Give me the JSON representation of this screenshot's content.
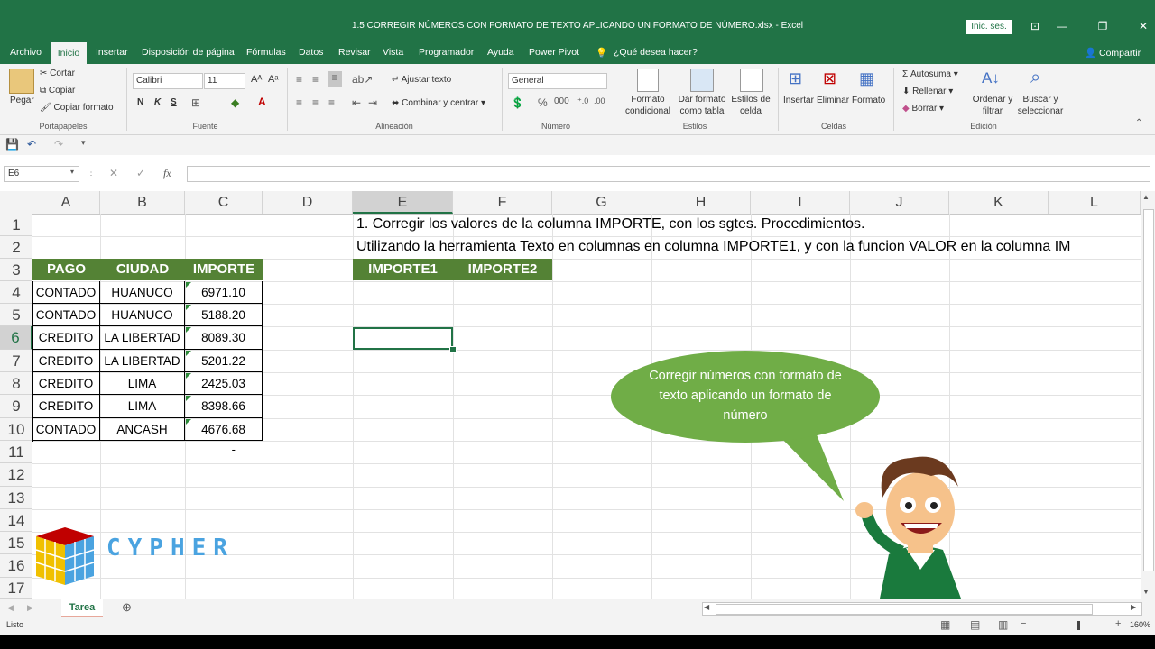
{
  "window": {
    "title": "1.5 CORREGIR NÚMEROS CON FORMATO DE TEXTO APLICANDO UN FORMATO DE NÚMERO.xlsx  -  Excel",
    "signin": "Inic. ses.",
    "share": "Compartir"
  },
  "tabs": [
    "Archivo",
    "Inicio",
    "Insertar",
    "Disposición de página",
    "Fórmulas",
    "Datos",
    "Revisar",
    "Vista",
    "Programador",
    "Ayuda",
    "Power Pivot",
    "¿Qué desea hacer?"
  ],
  "ribbon": {
    "portapapeles": {
      "label": "Portapapeles",
      "pegar": "Pegar",
      "cortar": "Cortar",
      "copiar": "Copiar",
      "copiar_formato": "Copiar formato"
    },
    "fuente": {
      "label": "Fuente",
      "font": "Calibri",
      "size": "11",
      "bold": "N",
      "italic": "K",
      "underline": "S"
    },
    "alineacion": {
      "label": "Alineación",
      "ajustar": "Ajustar texto",
      "combinar": "Combinar y centrar"
    },
    "numero": {
      "label": "Número",
      "format": "General"
    },
    "estilos": {
      "label": "Estilos",
      "formato_cond": "Formato\ncondicional",
      "formato_tabla": "Dar formato\ncomo tabla",
      "estilos_celda": "Estilos de\ncelda"
    },
    "celdas": {
      "label": "Celdas",
      "insertar": "Insertar",
      "eliminar": "Eliminar",
      "formato": "Formato"
    },
    "edicion": {
      "label": "Edición",
      "autosuma": "Autosuma",
      "rellenar": "Rellenar",
      "borrar": "Borrar",
      "ordenar": "Ordenar y\nfiltrar",
      "buscar": "Buscar y\nseleccionar"
    }
  },
  "namebox": "E6",
  "columns": [
    "A",
    "B",
    "C",
    "D",
    "E",
    "F",
    "G",
    "H",
    "I",
    "J",
    "K",
    "L"
  ],
  "rows": [
    "1",
    "2",
    "3",
    "4",
    "5",
    "6",
    "7",
    "8",
    "9",
    "10",
    "11",
    "12",
    "13",
    "14",
    "15",
    "16",
    "17"
  ],
  "sheet": {
    "line1": "1. Corregir los valores de la columna IMPORTE, con los sgtes. Procedimientos.",
    "line2": "Utilizando la herramienta Texto en columnas en columna IMPORTE1, y con la funcion VALOR en la columna IM",
    "table_headers": [
      "PAGO",
      "CIUDAD",
      "IMPORTE"
    ],
    "table_rows": [
      [
        "CONTADO",
        "HUANUCO",
        "6971.10"
      ],
      [
        "CONTADO",
        "HUANUCO",
        "5188.20"
      ],
      [
        "CREDITO",
        "LA LIBERTAD",
        "8089.30"
      ],
      [
        "CREDITO",
        "LA LIBERTAD",
        "5201.22"
      ],
      [
        "CREDITO",
        "LIMA",
        "2425.03"
      ],
      [
        "CREDITO",
        "LIMA",
        "8398.66"
      ],
      [
        "CONTADO",
        "ANCASH",
        "4676.68"
      ]
    ],
    "c11": "-",
    "importe_headers": [
      "IMPORTE1",
      "IMPORTE2"
    ]
  },
  "bubble_text": "Corregir números con formato de texto aplicando un formato de número",
  "logo_text": "CYPHER",
  "sheet_tab": "Tarea",
  "status": {
    "ready": "Listo",
    "zoom": "160%"
  },
  "colors": {
    "excel_green": "#217346",
    "header_green": "#548235",
    "bubble": "#70ad47"
  }
}
